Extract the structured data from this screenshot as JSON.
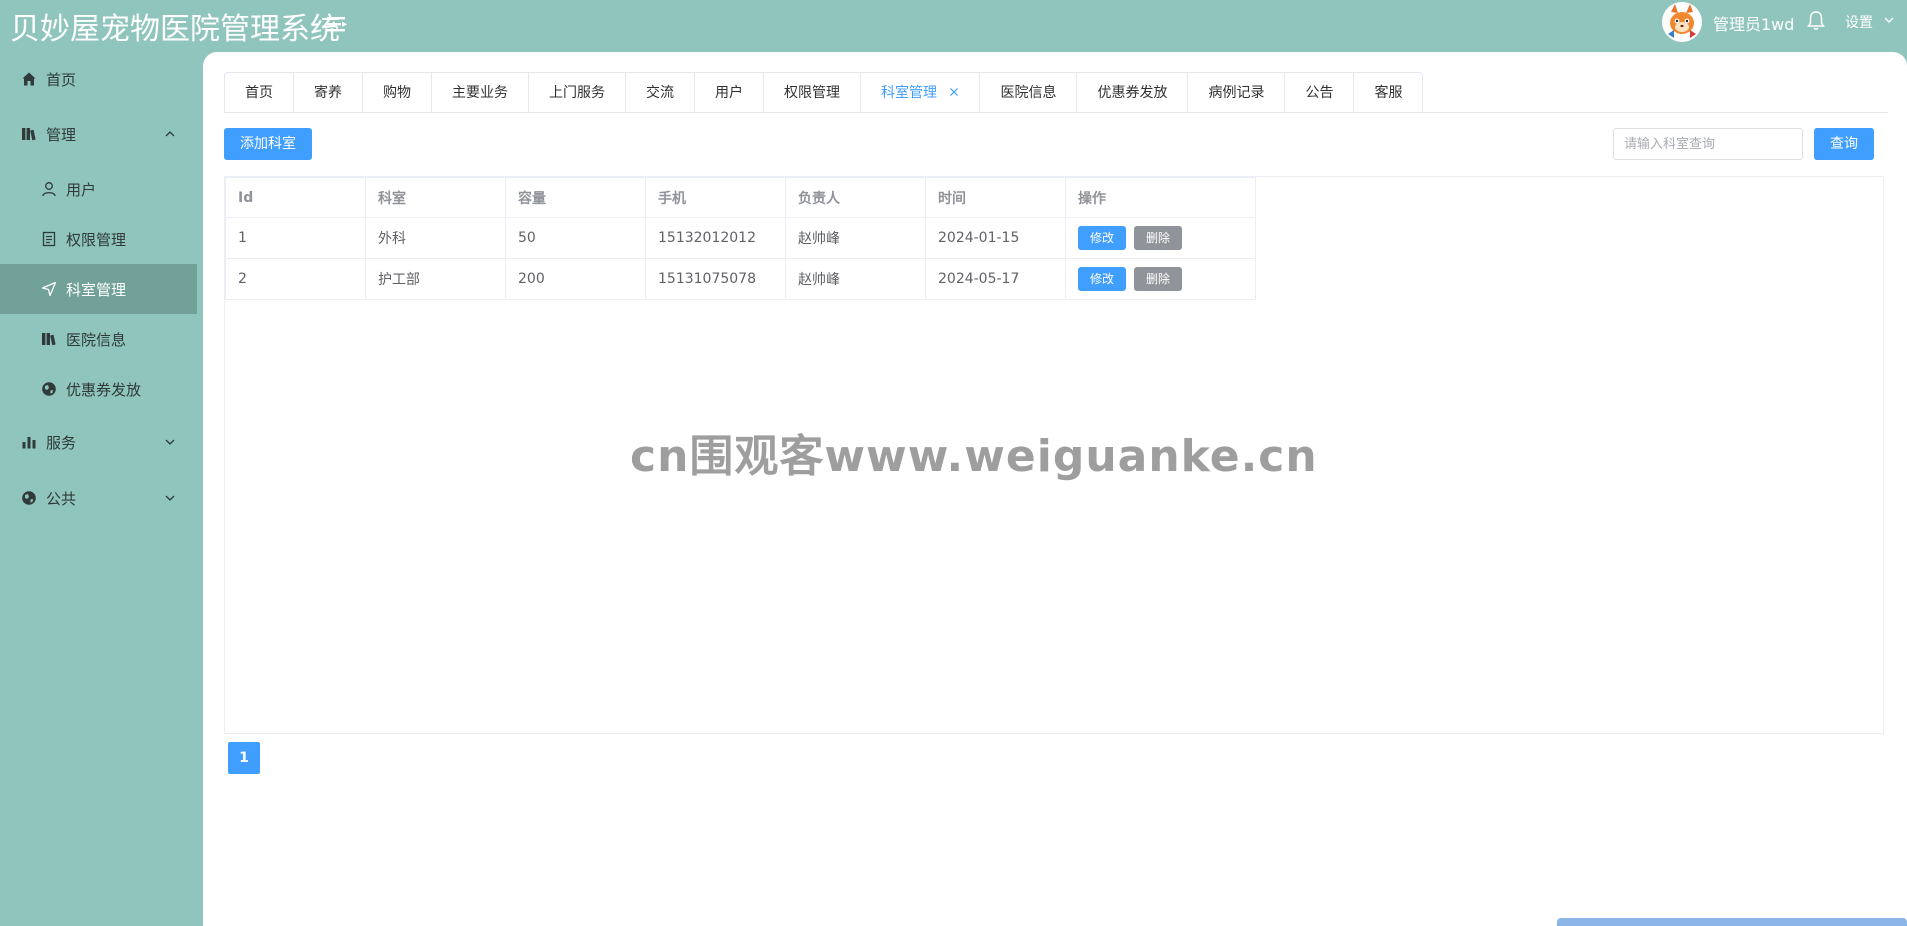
{
  "header": {
    "title": "贝妙屋宠物医院管理系统",
    "user_name": "管理员1wd",
    "settings_label": "设置"
  },
  "sidebar": {
    "items": [
      {
        "label": "首页",
        "icon": "home-icon"
      },
      {
        "label": "管理",
        "icon": "book-icon",
        "expanded": true
      },
      {
        "label": "服务",
        "icon": "bar-chart-icon",
        "expanded": false
      },
      {
        "label": "公共",
        "icon": "globe-icon",
        "expanded": false
      }
    ],
    "sub_items": [
      {
        "label": "用户",
        "icon": "user-icon"
      },
      {
        "label": "权限管理",
        "icon": "document-icon"
      },
      {
        "label": "科室管理",
        "icon": "navigation-icon",
        "active": true
      },
      {
        "label": "医院信息",
        "icon": "book-icon"
      },
      {
        "label": "优惠券发放",
        "icon": "globe-icon"
      }
    ]
  },
  "tabs": [
    {
      "label": "首页"
    },
    {
      "label": "寄养"
    },
    {
      "label": "购物"
    },
    {
      "label": "主要业务"
    },
    {
      "label": "上门服务"
    },
    {
      "label": "交流"
    },
    {
      "label": "用户"
    },
    {
      "label": "权限管理"
    },
    {
      "label": "科室管理",
      "active": true
    },
    {
      "label": "医院信息"
    },
    {
      "label": "优惠券发放"
    },
    {
      "label": "病例记录"
    },
    {
      "label": "公告"
    },
    {
      "label": "客服"
    }
  ],
  "toolbar": {
    "add_label": "添加科室",
    "search_placeholder": "请输入科室查询",
    "search_value": "",
    "query_label": "查询"
  },
  "table": {
    "columns": [
      "Id",
      "科室",
      "容量",
      "手机",
      "负责人",
      "时间",
      "操作"
    ],
    "rows": [
      {
        "id": "1",
        "dept": "外科",
        "capacity": "50",
        "phone": "15132012012",
        "head": "赵帅峰",
        "time": "2024-01-15"
      },
      {
        "id": "2",
        "dept": "护工部",
        "capacity": "200",
        "phone": "15131075078",
        "head": "赵帅峰",
        "time": "2024-05-17"
      }
    ],
    "edit_label": "修改",
    "delete_label": "删除"
  },
  "pagination": {
    "current": "1"
  },
  "watermark": "cn围观客www.weiguanke.cn",
  "colors": {
    "background": "#8fc5bc",
    "sidebar_active": "#72a199",
    "primary": "#409eff",
    "danger_gray": "#909399"
  }
}
